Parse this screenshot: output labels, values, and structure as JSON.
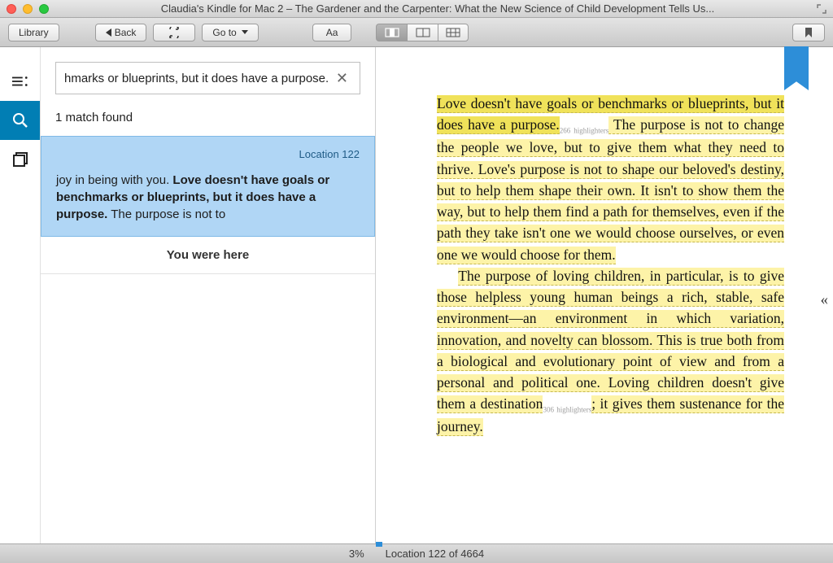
{
  "window": {
    "title": "Claudia's Kindle for Mac 2 – The Gardener and the Carpenter: What the New Science of Child Development Tells Us..."
  },
  "toolbar": {
    "library": "Library",
    "back": "Back",
    "goto": "Go to",
    "font": "Aa"
  },
  "search": {
    "query": "hmarks or blueprints, but it does have a purpose.",
    "match_count": "1 match found",
    "result": {
      "location": "Location 122",
      "before": "joy in being with you. ",
      "bold": "Love doesn't have goals or benchmarks or blueprints, but it does have a purpose.",
      "after": " The purpose is not to"
    },
    "you_were_here": "You were here"
  },
  "reader": {
    "srch_text": "Love doesn't have goals or benchmarks or blueprints, but it does have a purpose.",
    "hl_count1": "266 highlighters",
    "p1_rest": " The purpose is not to change the people we love, but to give them what they need to thrive. Love's purpose is not to shape our beloved's destiny, but to help them shape their own. It isn't to show them the way, but to help them find a path for themselves, even if the path they take isn't one we would choose ourselves, or even one we would choose for them.",
    "p2a": "The purpose of loving children, in particular, is to give those helpless young human beings a rich, stable, safe environment—an environment in which variation, innovation, and novelty can blossom. This is true both from a biological and evolutionary point of view and from a personal and political one. Loving children doesn't give them a destination",
    "hl_count2": "306 highlighters",
    "p2b": "; it gives them sustenance for the journey."
  },
  "status": {
    "percent": "3%",
    "location": "Location 122 of 4664"
  },
  "pageturn": "«"
}
